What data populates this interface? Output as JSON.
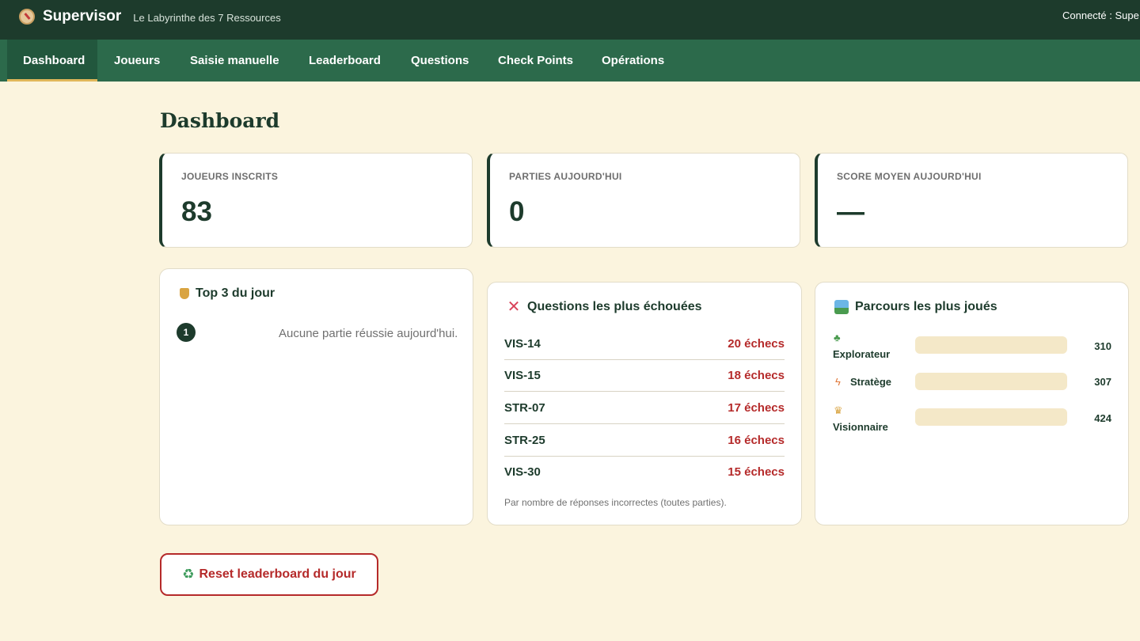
{
  "app": {
    "name": "Supervisor",
    "subtitle": "Le Labyrinthe des 7 Ressources",
    "connected_text": "Connecté : Supe"
  },
  "nav": {
    "tabs": [
      {
        "label": "Dashboard",
        "active": true
      },
      {
        "label": "Joueurs",
        "active": false
      },
      {
        "label": "Saisie manuelle",
        "active": false
      },
      {
        "label": "Leaderboard",
        "active": false
      },
      {
        "label": "Questions",
        "active": false
      },
      {
        "label": "Check Points",
        "active": false
      },
      {
        "label": "Opérations",
        "active": false
      }
    ]
  },
  "page": {
    "title": "Dashboard"
  },
  "stats": [
    {
      "label": "JOUEURS INSCRITS",
      "value": "83"
    },
    {
      "label": "PARTIES AUJOURD'HUI",
      "value": "0"
    },
    {
      "label": "SCORE MOYEN AUJOURD'HUI",
      "value": "—"
    }
  ],
  "top3": {
    "title": "Top 3 du jour",
    "icon": "trophy-icon",
    "rank": "1",
    "empty_message": "Aucune partie réussie aujourd'hui."
  },
  "failed_questions": {
    "title": "Questions les plus échouées",
    "icon": "cross-icon",
    "rows": [
      {
        "id": "VIS-14",
        "fails": "20 échecs"
      },
      {
        "id": "VIS-15",
        "fails": "18 échecs"
      },
      {
        "id": "STR-07",
        "fails": "17 échecs"
      },
      {
        "id": "STR-25",
        "fails": "16 échecs"
      },
      {
        "id": "VIS-30",
        "fails": "15 échecs"
      }
    ],
    "note": "Par nombre de réponses incorrectes (toutes parties)."
  },
  "routes": {
    "title": "Parcours les plus joués",
    "icon": "map-icon",
    "items": [
      {
        "label": "Explorateur",
        "icon": "seedling-icon",
        "count": "310"
      },
      {
        "label": "Stratège",
        "icon": "lightning-icon",
        "count": "307"
      },
      {
        "label": "Visionnaire",
        "icon": "crown-icon",
        "count": "424"
      }
    ]
  },
  "actions": {
    "reset_label": "Reset leaderboard du jour",
    "reset_icon": "recycle-icon"
  },
  "colors": {
    "header_bg": "#1d3b2c",
    "nav_bg": "#2c6a4b",
    "active_underline": "#e0b75a",
    "page_bg": "#fbf4de",
    "danger": "#b52a2a",
    "bar_bg": "#f4e8c8"
  }
}
